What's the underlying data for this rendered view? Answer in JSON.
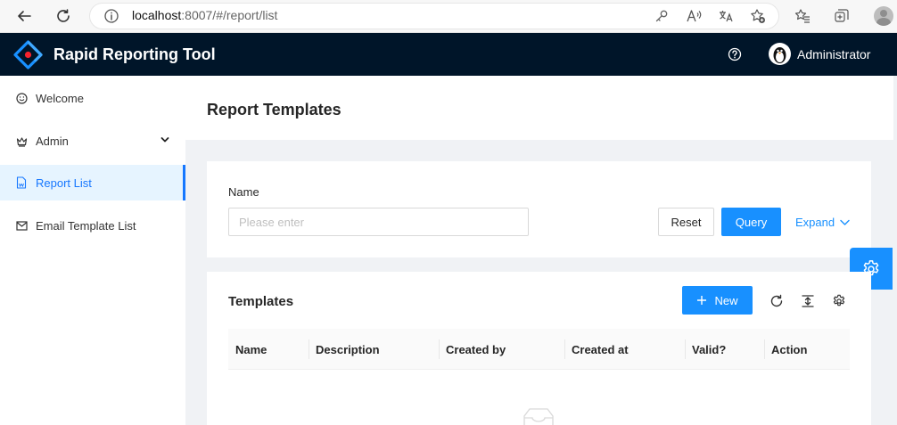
{
  "browser": {
    "url_host": "localhost",
    "url_path": ":8007/#/report/list"
  },
  "app": {
    "title": "Rapid Reporting Tool",
    "user": "Administrator",
    "brand_color": "#1890ff",
    "header_color": "#001529"
  },
  "sidebar": {
    "items": [
      {
        "label": "Welcome",
        "icon": "smile-icon"
      },
      {
        "label": "Admin",
        "icon": "crown-icon"
      },
      {
        "label": "Report List",
        "icon": "file-icon",
        "active": true
      },
      {
        "label": "Email Template List",
        "icon": "mail-icon"
      }
    ]
  },
  "page": {
    "title": "Report Templates"
  },
  "search": {
    "name_label": "Name",
    "name_placeholder": "Please enter",
    "reset_label": "Reset",
    "query_label": "Query",
    "expand_label": "Expand"
  },
  "table": {
    "title": "Templates",
    "new_label": "New",
    "columns": [
      "Name",
      "Description",
      "Created by",
      "Created at",
      "Valid?",
      "Action"
    ]
  }
}
